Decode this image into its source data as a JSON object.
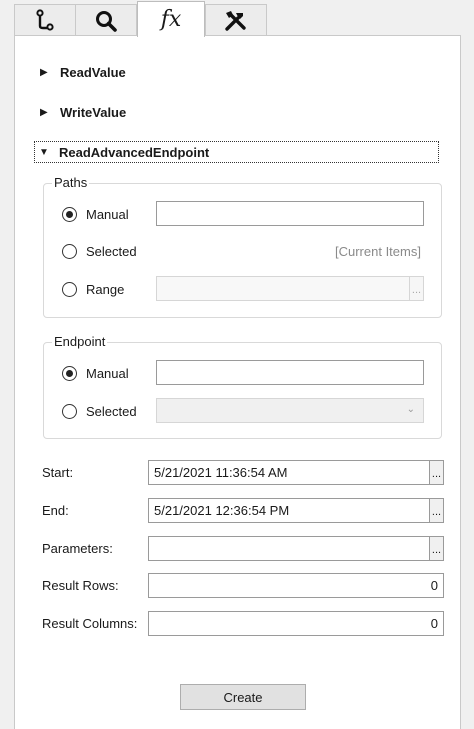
{
  "tabs": [
    {
      "icon": "git-branch-icon",
      "active": false
    },
    {
      "icon": "search-icon",
      "active": false
    },
    {
      "label": "fx",
      "icon": "function-icon",
      "active": true
    },
    {
      "icon": "tools-icon",
      "active": false
    }
  ],
  "sections": {
    "read_value": "ReadValue",
    "write_value": "WriteValue",
    "read_advanced_endpoint": "ReadAdvancedEndpoint"
  },
  "paths": {
    "legend": "Paths",
    "manual_label": "Manual",
    "manual_value": "",
    "selected_label": "Selected",
    "selected_hint": "[Current Items]",
    "range_label": "Range",
    "range_value": "",
    "range_button": "...",
    "selected_option": "manual"
  },
  "endpoint": {
    "legend": "Endpoint",
    "manual_label": "Manual",
    "manual_value": "",
    "selected_label": "Selected",
    "selected_value": "",
    "selected_option": "manual"
  },
  "fields": {
    "start_label": "Start:",
    "start_value": "5/21/2021 11:36:54 AM",
    "end_label": "End:",
    "end_value": "5/21/2021 12:36:54 PM",
    "parameters_label": "Parameters:",
    "parameters_value": "",
    "result_rows_label": "Result Rows:",
    "result_rows_value": "0",
    "result_columns_label": "Result Columns:",
    "result_columns_value": "0",
    "ellipsis": "..."
  },
  "create_button": "Create"
}
